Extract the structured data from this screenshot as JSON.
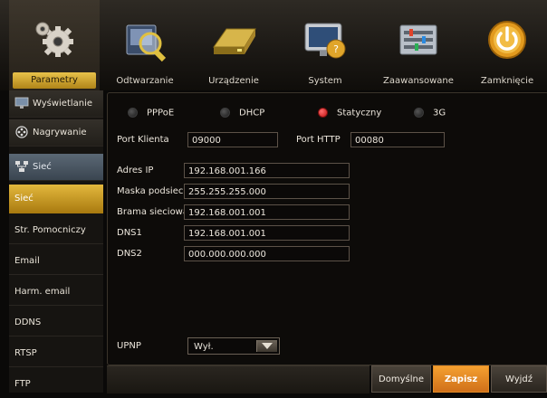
{
  "tabs": [
    {
      "label": "Parametry",
      "icon": "gears-icon"
    },
    {
      "label": "Odtwarzanie",
      "icon": "playback-magnifier-icon"
    },
    {
      "label": "Urządzenie",
      "icon": "hard-drive-icon"
    },
    {
      "label": "System",
      "icon": "system-monitor-icon"
    },
    {
      "label": "Zaawansowane",
      "icon": "advanced-panel-icon"
    },
    {
      "label": "Zamknięcie",
      "icon": "power-icon"
    }
  ],
  "sidebar": {
    "items": [
      {
        "label": "Wyświetlanie",
        "icon": "monitor-icon"
      },
      {
        "label": "Nagrywanie",
        "icon": "film-reel-icon"
      },
      {
        "label": "Sieć",
        "icon": "network-icon"
      },
      {
        "label": "Sieć"
      },
      {
        "label": "Str. Pomocniczy"
      },
      {
        "label": "Email"
      },
      {
        "label": "Harm. email"
      },
      {
        "label": "DDNS"
      },
      {
        "label": "RTSP"
      },
      {
        "label": "FTP"
      }
    ]
  },
  "network": {
    "modes": [
      {
        "label": "PPPoE",
        "selected": false
      },
      {
        "label": "DHCP",
        "selected": false
      },
      {
        "label": "Statyczny",
        "selected": true
      },
      {
        "label": "3G",
        "selected": false
      }
    ],
    "client_port_label": "Port Klienta",
    "client_port": "09000",
    "http_port_label": "Port HTTP",
    "http_port": "00080",
    "ip_label": "Adres IP",
    "ip": "192.168.001.166",
    "mask_label": "Maska podsieci",
    "mask": "255.255.255.000",
    "gateway_label": "Brama sieciowa",
    "gateway": "192.168.001.001",
    "dns1_label": "DNS1",
    "dns1": "192.168.001.001",
    "dns2_label": "DNS2",
    "dns2": "000.000.000.000",
    "upnp_label": "UPNP",
    "upnp_value": "Wył."
  },
  "buttons": {
    "default_label": "Domyślne",
    "save_label": "Zapisz",
    "exit_label": "Wyjdź"
  },
  "colors": {
    "accent_gold": "#d9a92e",
    "save_orange": "#e8891f",
    "radio_selected": "#e01c1c"
  }
}
